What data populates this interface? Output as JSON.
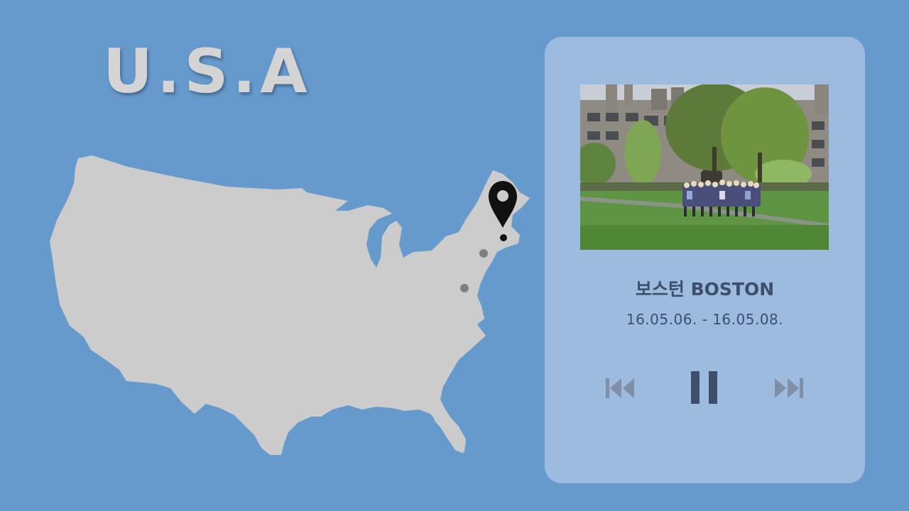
{
  "header": {
    "title": "U.S.A"
  },
  "trip": {
    "city": "보스턴 BOSTON",
    "dates": "16.05.06. - 16.05.08."
  },
  "player": {
    "state": "playing",
    "controls": [
      "previous",
      "pause",
      "next"
    ]
  },
  "map": {
    "active_pin": "Boston",
    "stops": 3
  },
  "colors": {
    "background": "#6699cc",
    "card": "#9dbadf",
    "map_land": "#cccccc",
    "text": "#3d4f6a",
    "active_control": "#3d4f6a",
    "inactive_control": "#7f8fa6"
  },
  "icons": {
    "pin": "map-pin-icon",
    "previous": "skip-previous-icon",
    "pause": "pause-icon",
    "next": "skip-next-icon"
  }
}
